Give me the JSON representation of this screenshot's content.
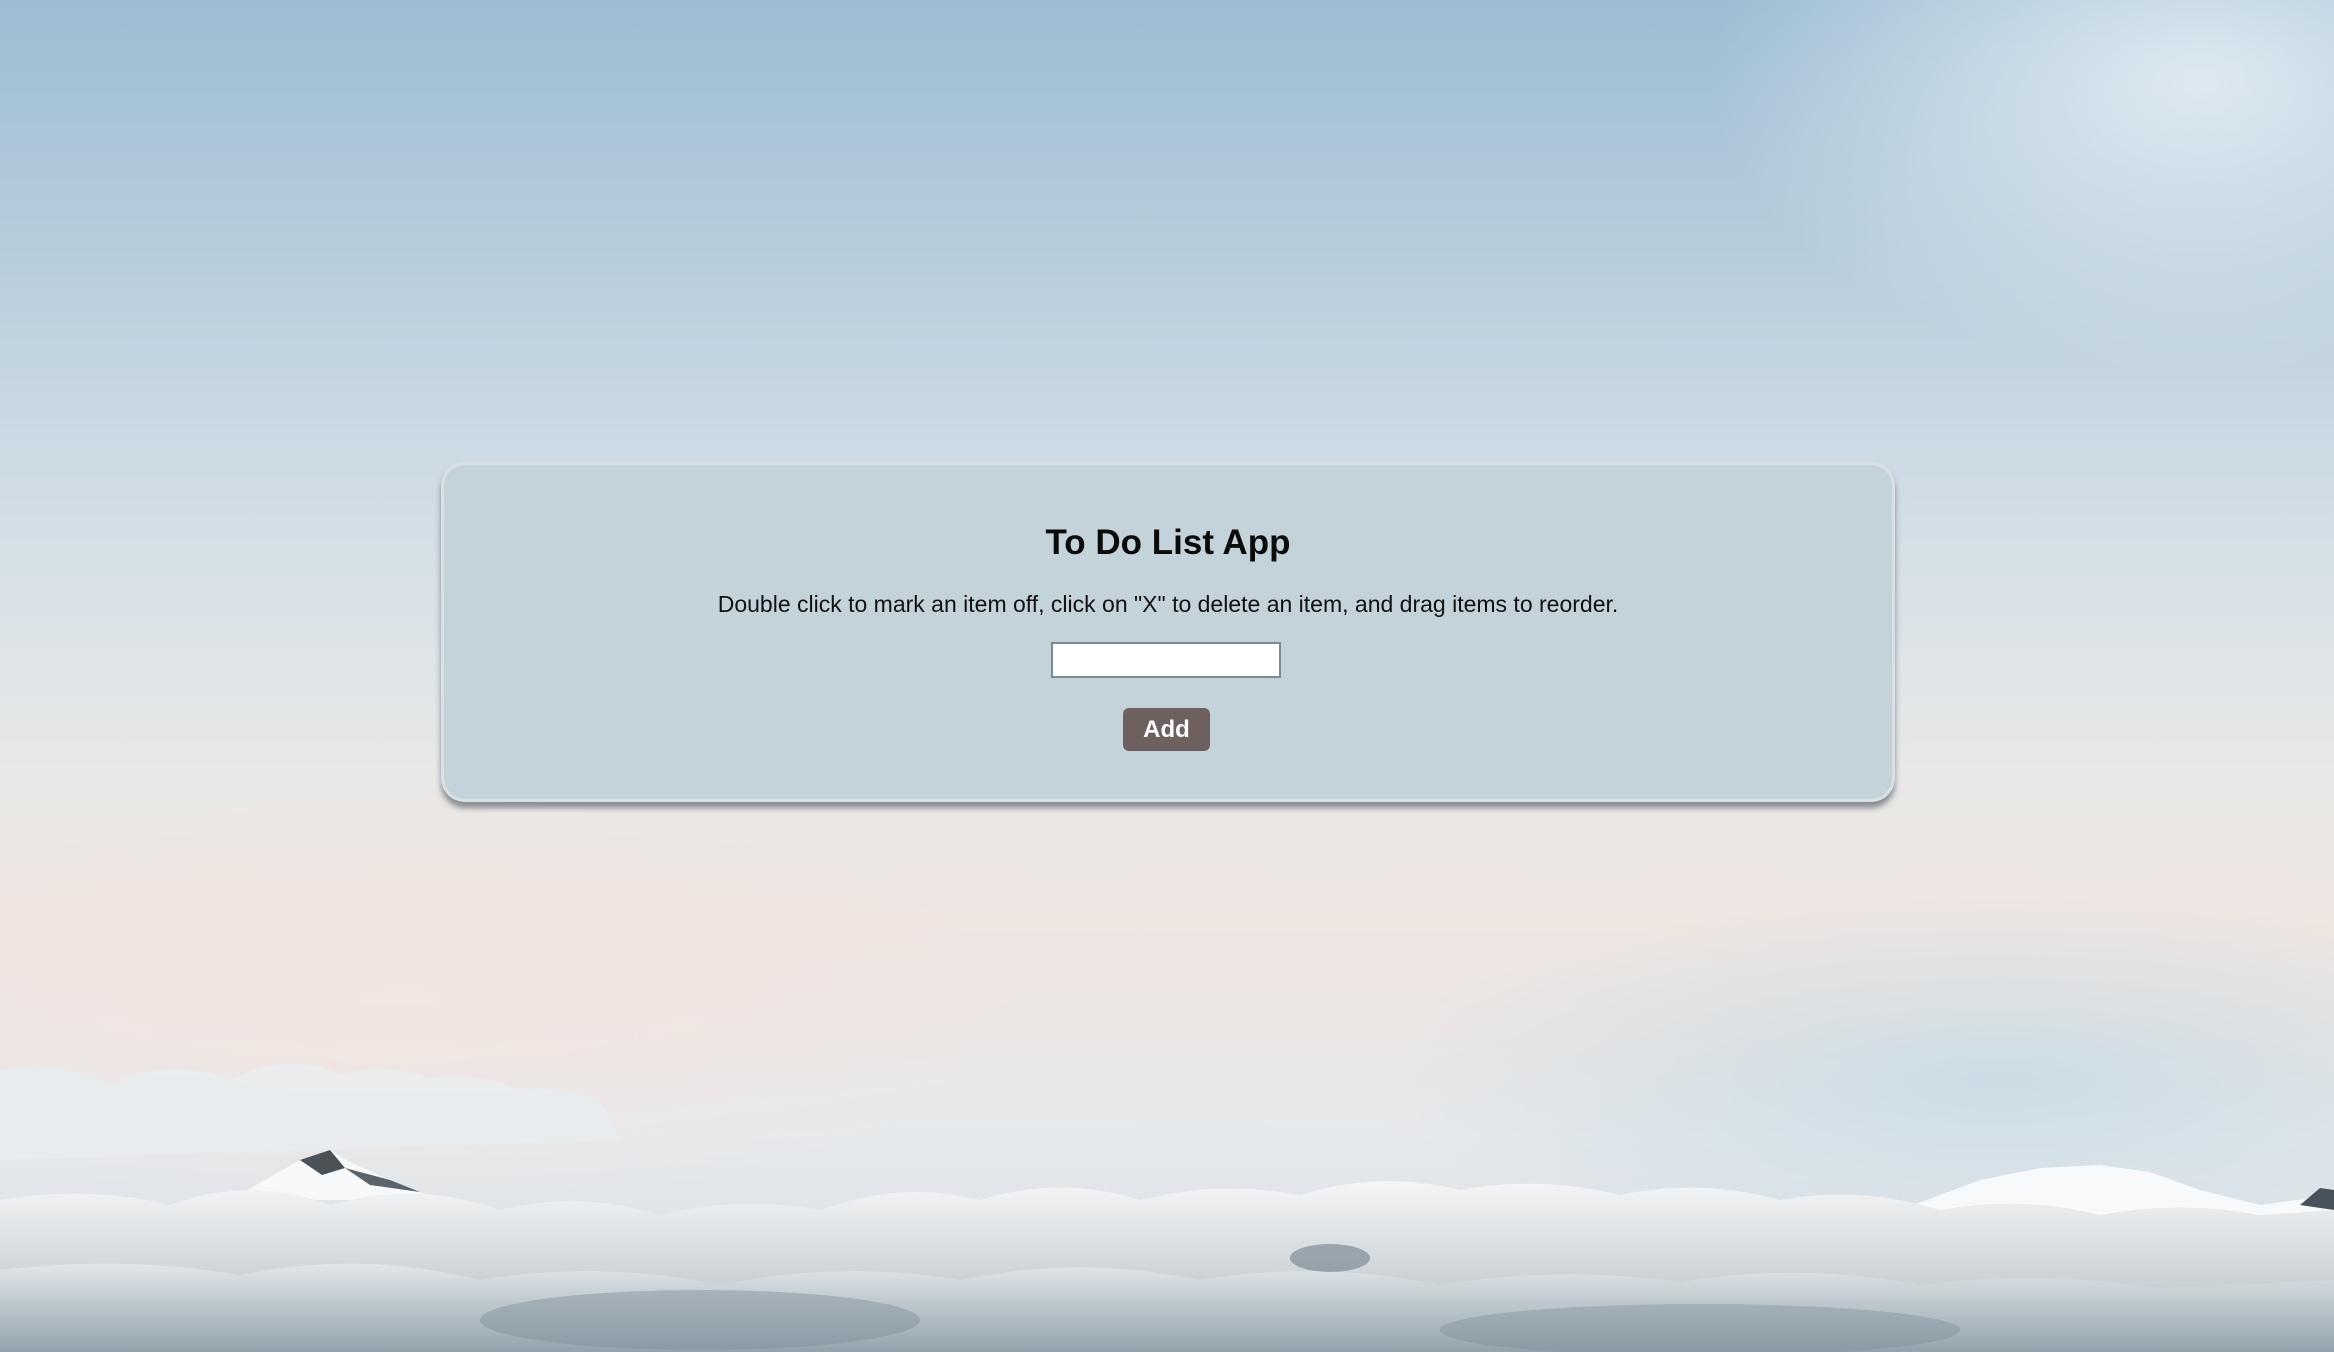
{
  "app": {
    "title": "To Do List App",
    "instructions": "Double click to mark an item off, click on \"X\" to delete an item, and drag items to reorder."
  },
  "task_input": {
    "value": "",
    "placeholder": ""
  },
  "add_button": {
    "label": "Add"
  },
  "items": [],
  "colors": {
    "card_background": "#c4d3da",
    "button_background": "#6f6060",
    "button_text": "#ffffff",
    "title_text": "#0b0b0b"
  },
  "background": {
    "icon": "sky-clouds-mountains-image"
  }
}
